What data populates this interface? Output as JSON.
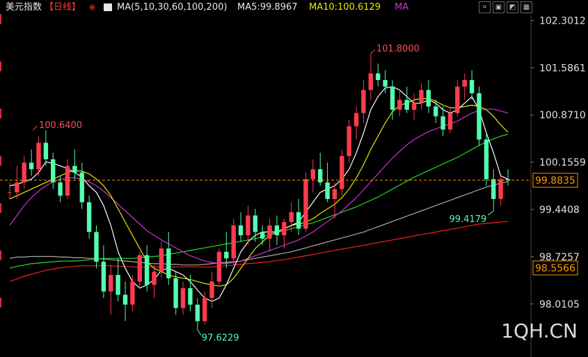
{
  "header": {
    "instrument": "美元指数",
    "period": "【日线】",
    "ma_settings": "MA(5,10,30,60,100,200)",
    "ma5": "MA5:99.8967",
    "ma10": "MA10:100.6129",
    "ma30": "MA"
  },
  "watermark": "1QH.CN",
  "colors": {
    "up": "#ff3b4e",
    "down": "#54ffb0",
    "ma5": "#ffffff",
    "ma10": "#e8e800",
    "ma30": "#cc33cc",
    "ma60": "#22dd22",
    "ma100": "#aaaaaa",
    "ma200": "#ee2222",
    "price_line": "#ff9900",
    "bg": "#000000"
  },
  "chart_data": {
    "type": "candlestick",
    "y_ticks": [
      "102.3012",
      "101.5861",
      "100.8710",
      "100.1559",
      "99.4408",
      "98.7257",
      "98.0105"
    ],
    "ylim": [
      97.45,
      102.38
    ],
    "current_price": "99.8835",
    "right_marker": "98.5566",
    "annotations": {
      "high_1": "100.6400",
      "high_2": "101.8000",
      "low_1": "97.6229",
      "low_2": "99.4179"
    },
    "ohlc": [
      [
        99.7,
        99.85,
        99.6,
        99.7
      ],
      [
        99.7,
        100.1,
        99.6,
        99.85
      ],
      [
        99.85,
        100.25,
        99.75,
        100.15
      ],
      [
        100.15,
        100.35,
        99.95,
        100.05
      ],
      [
        100.05,
        100.55,
        99.95,
        100.45
      ],
      [
        100.45,
        100.64,
        100.1,
        100.2
      ],
      [
        100.2,
        100.3,
        99.75,
        99.85
      ],
      [
        99.85,
        99.95,
        99.55,
        99.65
      ],
      [
        99.65,
        100.2,
        99.6,
        100.1
      ],
      [
        100.1,
        100.35,
        99.9,
        100.0
      ],
      [
        100.0,
        100.15,
        99.45,
        99.55
      ],
      [
        99.55,
        99.65,
        99.0,
        99.1
      ],
      [
        99.1,
        99.2,
        98.55,
        98.65
      ],
      [
        98.65,
        98.9,
        98.1,
        98.2
      ],
      [
        98.2,
        98.6,
        97.85,
        98.45
      ],
      [
        98.45,
        98.7,
        98.05,
        98.15
      ],
      [
        98.15,
        98.35,
        97.75,
        98.0
      ],
      [
        98.0,
        98.45,
        97.9,
        98.35
      ],
      [
        98.35,
        98.8,
        98.25,
        98.75
      ],
      [
        98.75,
        98.9,
        98.2,
        98.3
      ],
      [
        98.3,
        98.6,
        98.1,
        98.5
      ],
      [
        98.5,
        98.95,
        98.4,
        98.85
      ],
      [
        98.85,
        99.1,
        98.3,
        98.4
      ],
      [
        98.4,
        98.5,
        97.85,
        97.95
      ],
      [
        97.95,
        98.35,
        97.85,
        98.25
      ],
      [
        98.25,
        98.45,
        97.9,
        98.0
      ],
      [
        98.0,
        98.1,
        97.62,
        97.75
      ],
      [
        97.75,
        98.2,
        97.7,
        98.1
      ],
      [
        98.1,
        98.5,
        97.95,
        98.35
      ],
      [
        98.35,
        98.85,
        98.3,
        98.8
      ],
      [
        98.8,
        99.1,
        98.55,
        98.7
      ],
      [
        98.7,
        99.3,
        98.6,
        99.2
      ],
      [
        99.2,
        99.4,
        98.95,
        99.05
      ],
      [
        99.05,
        99.5,
        98.9,
        99.35
      ],
      [
        99.35,
        99.45,
        98.95,
        99.1
      ],
      [
        99.1,
        99.2,
        98.9,
        99.0
      ],
      [
        99.0,
        99.3,
        98.8,
        99.2
      ],
      [
        99.2,
        99.35,
        98.9,
        99.05
      ],
      [
        99.05,
        99.3,
        98.85,
        99.25
      ],
      [
        99.25,
        99.55,
        99.1,
        99.4
      ],
      [
        99.4,
        99.6,
        99.05,
        99.15
      ],
      [
        99.15,
        100.0,
        99.1,
        99.9
      ],
      [
        99.9,
        100.2,
        99.7,
        100.05
      ],
      [
        100.05,
        100.3,
        99.8,
        99.85
      ],
      [
        99.85,
        100.15,
        99.55,
        99.6
      ],
      [
        99.6,
        99.85,
        99.3,
        99.75
      ],
      [
        99.75,
        100.35,
        99.65,
        100.25
      ],
      [
        100.25,
        100.8,
        100.15,
        100.7
      ],
      [
        100.7,
        101.0,
        100.5,
        100.9
      ],
      [
        100.9,
        101.4,
        100.75,
        101.25
      ],
      [
        101.25,
        101.8,
        101.1,
        101.5
      ],
      [
        101.5,
        101.65,
        101.3,
        101.4
      ],
      [
        101.4,
        101.55,
        101.2,
        101.3
      ],
      [
        101.3,
        101.4,
        100.8,
        100.95
      ],
      [
        100.95,
        101.25,
        100.85,
        101.1
      ],
      [
        101.1,
        101.3,
        100.9,
        100.95
      ],
      [
        100.95,
        101.2,
        100.8,
        101.05
      ],
      [
        101.05,
        101.35,
        100.95,
        101.25
      ],
      [
        101.25,
        101.4,
        100.9,
        101.0
      ],
      [
        101.0,
        101.1,
        100.75,
        100.85
      ],
      [
        100.85,
        101.0,
        100.55,
        100.65
      ],
      [
        100.65,
        101.0,
        100.6,
        100.9
      ],
      [
        100.9,
        101.4,
        100.85,
        101.3
      ],
      [
        101.3,
        101.5,
        101.1,
        101.4
      ],
      [
        101.4,
        101.55,
        101.1,
        101.2
      ],
      [
        101.2,
        101.3,
        100.4,
        100.5
      ],
      [
        100.5,
        100.6,
        99.8,
        99.9
      ],
      [
        99.9,
        100.05,
        99.42,
        99.6
      ],
      [
        99.6,
        99.95,
        99.5,
        99.9
      ],
      [
        99.9,
        100.05,
        99.8,
        99.88
      ]
    ],
    "ma5": [
      99.8,
      99.82,
      99.86,
      99.9,
      100.0,
      100.16,
      100.14,
      100.1,
      100.06,
      100.0,
      99.93,
      99.8,
      99.7,
      99.5,
      99.2,
      98.8,
      98.55,
      98.35,
      98.25,
      98.3,
      98.38,
      98.52,
      98.55,
      98.5,
      98.45,
      98.35,
      98.22,
      98.1,
      98.05,
      98.1,
      98.3,
      98.55,
      98.8,
      98.95,
      99.05,
      99.1,
      99.1,
      99.1,
      99.15,
      99.2,
      99.25,
      99.4,
      99.55,
      99.7,
      99.75,
      99.8,
      99.9,
      100.05,
      100.3,
      100.6,
      100.95,
      101.15,
      101.28,
      101.3,
      101.25,
      101.15,
      101.05,
      101.05,
      101.1,
      101.05,
      100.95,
      100.9,
      100.95,
      101.05,
      101.15,
      100.95,
      100.6,
      100.3,
      99.95,
      99.9
    ],
    "ma10": [
      99.6,
      99.65,
      99.7,
      99.75,
      99.8,
      99.85,
      99.9,
      99.95,
      100.0,
      100.03,
      100.02,
      99.98,
      99.9,
      99.8,
      99.65,
      99.45,
      99.25,
      99.05,
      98.85,
      98.65,
      98.55,
      98.5,
      98.45,
      98.42,
      98.4,
      98.38,
      98.35,
      98.32,
      98.3,
      98.28,
      98.3,
      98.4,
      98.55,
      98.7,
      98.85,
      98.95,
      99.05,
      99.1,
      99.15,
      99.2,
      99.22,
      99.25,
      99.3,
      99.38,
      99.45,
      99.52,
      99.62,
      99.75,
      99.92,
      100.12,
      100.35,
      100.55,
      100.75,
      100.92,
      101.02,
      101.05,
      101.1,
      101.12,
      101.12,
      101.08,
      101.02,
      100.98,
      100.98,
      101.0,
      101.02,
      101.0,
      100.95,
      100.85,
      100.72,
      100.61
    ],
    "ma30": [
      99.2,
      99.35,
      99.5,
      99.62,
      99.72,
      99.8,
      99.86,
      99.9,
      99.92,
      99.92,
      99.9,
      99.86,
      99.8,
      99.72,
      99.62,
      99.52,
      99.42,
      99.32,
      99.22,
      99.12,
      99.05,
      98.98,
      98.92,
      98.86,
      98.8,
      98.74,
      98.7,
      98.66,
      98.64,
      98.62,
      98.62,
      98.64,
      98.66,
      98.7,
      98.74,
      98.78,
      98.82,
      98.86,
      98.9,
      98.94,
      98.98,
      99.04,
      99.1,
      99.18,
      99.26,
      99.34,
      99.42,
      99.52,
      99.62,
      99.74,
      99.86,
      99.98,
      100.1,
      100.22,
      100.32,
      100.42,
      100.5,
      100.56,
      100.62,
      100.66,
      100.7,
      100.74,
      100.78,
      100.84,
      100.9,
      100.94,
      100.96,
      100.96,
      100.93,
      100.9
    ],
    "ma60": [
      98.55,
      98.58,
      98.6,
      98.62,
      98.63,
      98.64,
      98.65,
      98.66,
      98.66,
      98.66,
      98.67,
      98.68,
      98.69,
      98.7,
      98.7,
      98.7,
      98.7,
      98.7,
      98.71,
      98.72,
      98.73,
      98.74,
      98.76,
      98.78,
      98.8,
      98.82,
      98.84,
      98.86,
      98.88,
      98.9,
      98.92,
      98.94,
      98.96,
      98.98,
      99.0,
      99.03,
      99.06,
      99.09,
      99.12,
      99.15,
      99.18,
      99.21,
      99.24,
      99.28,
      99.32,
      99.36,
      99.4,
      99.44,
      99.48,
      99.53,
      99.58,
      99.63,
      99.69,
      99.75,
      99.81,
      99.87,
      99.93,
      99.98,
      100.03,
      100.08,
      100.13,
      100.18,
      100.23,
      100.29,
      100.35,
      100.41,
      100.46,
      100.51,
      100.55,
      100.58
    ],
    "ma100": [
      98.7,
      98.72,
      98.72,
      98.73,
      98.73,
      98.73,
      98.73,
      98.72,
      98.72,
      98.71,
      98.71,
      98.7,
      98.7,
      98.69,
      98.68,
      98.67,
      98.66,
      98.65,
      98.64,
      98.63,
      98.62,
      98.62,
      98.61,
      98.61,
      98.6,
      98.6,
      98.6,
      98.61,
      98.62,
      98.63,
      98.64,
      98.65,
      98.66,
      98.68,
      98.7,
      98.72,
      98.74,
      98.76,
      98.78,
      98.8,
      98.83,
      98.86,
      98.89,
      98.92,
      98.95,
      98.98,
      99.01,
      99.04,
      99.07,
      99.1,
      99.14,
      99.18,
      99.22,
      99.26,
      99.3,
      99.34,
      99.38,
      99.42,
      99.46,
      99.5,
      99.54,
      99.58,
      99.62,
      99.66,
      99.7,
      99.74,
      99.78,
      99.81,
      99.84,
      99.86
    ],
    "ma200": [
      98.35,
      98.39,
      98.43,
      98.46,
      98.49,
      98.52,
      98.54,
      98.56,
      98.57,
      98.58,
      98.59,
      98.59,
      98.59,
      98.59,
      98.59,
      98.58,
      98.58,
      98.57,
      98.57,
      98.57,
      98.57,
      98.57,
      98.57,
      98.57,
      98.57,
      98.57,
      98.57,
      98.57,
      98.57,
      98.58,
      98.59,
      98.6,
      98.61,
      98.62,
      98.63,
      98.64,
      98.65,
      98.67,
      98.68,
      98.7,
      98.72,
      98.74,
      98.76,
      98.78,
      98.8,
      98.82,
      98.84,
      98.86,
      98.88,
      98.9,
      98.92,
      98.94,
      98.96,
      98.98,
      99.0,
      99.02,
      99.04,
      99.06,
      99.08,
      99.1,
      99.12,
      99.14,
      99.16,
      99.18,
      99.2,
      99.22,
      99.23,
      99.24,
      99.25,
      99.26
    ]
  }
}
